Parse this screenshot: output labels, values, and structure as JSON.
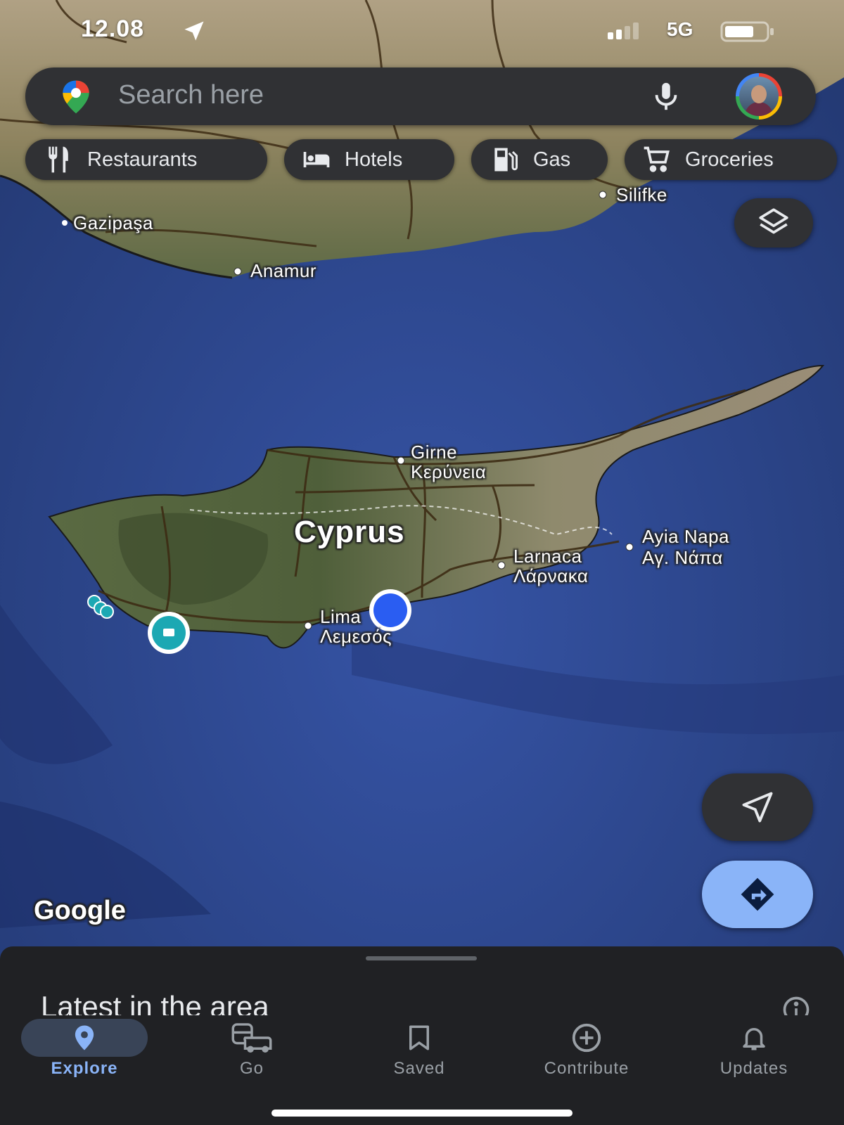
{
  "status_bar": {
    "time": "12.08",
    "network": "5G"
  },
  "search": {
    "placeholder": "Search here"
  },
  "chips": [
    {
      "label": "Restaurants",
      "icon": "restaurant-icon"
    },
    {
      "label": "Hotels",
      "icon": "hotel-icon"
    },
    {
      "label": "Gas",
      "icon": "gas-icon"
    },
    {
      "label": "Groceries",
      "icon": "cart-icon"
    }
  ],
  "map": {
    "labels": {
      "country": "Cyprus",
      "gazipasa": "Gazipaşa",
      "anamur": "Anamur",
      "silifke": "Silifke",
      "girne": "Girne",
      "kerynia": "Κερύνεια",
      "ayia_napa": "Ayia Napa",
      "ayia_napa_gr": "Αγ. Νάπα",
      "larnaca": "Larnaca",
      "larnaca_gr": "Λάρνακα",
      "limassol": "Lima",
      "limassol_gr": "Λεμεσός"
    },
    "watermark": "Google",
    "colors": {
      "sea": "#2c4590",
      "land": "#8b7d5e",
      "location_dot": "#2a5df2"
    }
  },
  "sheet": {
    "title": "Latest in the area"
  },
  "nav": [
    {
      "label": "Explore",
      "icon": "explore-pin-icon",
      "active": true
    },
    {
      "label": "Go",
      "icon": "commute-icon",
      "active": false
    },
    {
      "label": "Saved",
      "icon": "bookmark-icon",
      "active": false
    },
    {
      "label": "Contribute",
      "icon": "add-circle-icon",
      "active": false
    },
    {
      "label": "Updates",
      "icon": "bell-icon",
      "active": false
    }
  ],
  "accent": "#8ab4f8"
}
